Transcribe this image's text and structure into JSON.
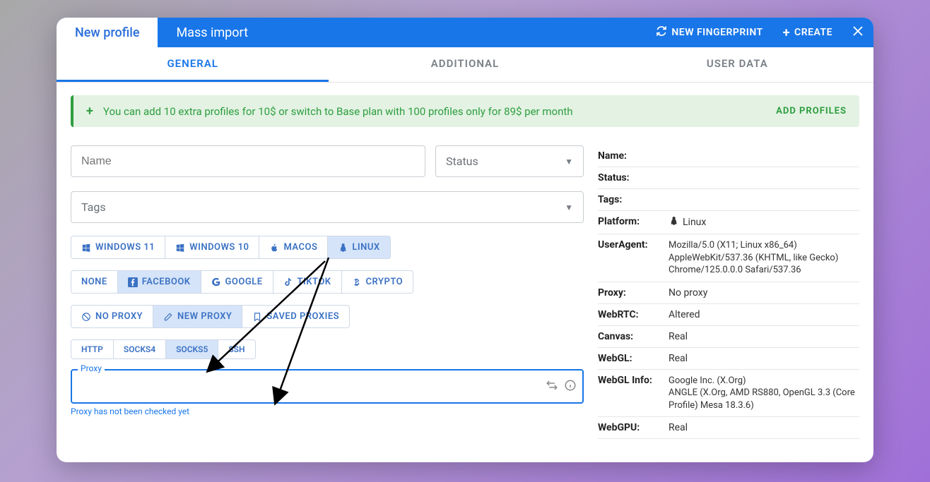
{
  "topbar": {
    "tabs": [
      {
        "label": "New profile",
        "active": true
      },
      {
        "label": "Mass import",
        "active": false
      }
    ],
    "new_fingerprint": "NEW FINGERPRINT",
    "create": "CREATE"
  },
  "subtabs": [
    {
      "label": "GENERAL",
      "active": true
    },
    {
      "label": "ADDITIONAL",
      "active": false
    },
    {
      "label": "USER DATA",
      "active": false
    }
  ],
  "banner": {
    "text": "You can add 10 extra profiles for 10$ or switch to Base plan with 100 profiles only for 89$ per month",
    "action": "ADD PROFILES"
  },
  "form": {
    "name_placeholder": "Name",
    "status_placeholder": "Status",
    "tags_placeholder": "Tags"
  },
  "os_chips": [
    {
      "label": "WINDOWS 11",
      "icon": "windows-icon",
      "selected": false
    },
    {
      "label": "WINDOWS 10",
      "icon": "windows-icon",
      "selected": false
    },
    {
      "label": "MACOS",
      "icon": "apple-icon",
      "selected": false
    },
    {
      "label": "LINUX",
      "icon": "linux-icon",
      "selected": true
    }
  ],
  "app_chips": [
    {
      "label": "NONE",
      "icon": "",
      "selected": false
    },
    {
      "label": "FACEBOOK",
      "icon": "facebook-icon",
      "selected": true
    },
    {
      "label": "GOOGLE",
      "icon": "google-icon",
      "selected": false
    },
    {
      "label": "TIKTOK",
      "icon": "tiktok-icon",
      "selected": false
    },
    {
      "label": "CRYPTO",
      "icon": "bitcoin-icon",
      "selected": false
    }
  ],
  "proxy_mode_chips": [
    {
      "label": "NO PROXY",
      "icon": "noproxy-icon",
      "selected": false
    },
    {
      "label": "NEW PROXY",
      "icon": "edit-icon",
      "selected": true
    },
    {
      "label": "SAVED PROXIES",
      "icon": "bookmark-icon",
      "selected": false
    }
  ],
  "proxy_type_chips": [
    {
      "label": "HTTP",
      "selected": false
    },
    {
      "label": "SOCKS4",
      "selected": false
    },
    {
      "label": "SOCKS5",
      "selected": true
    },
    {
      "label": "SSH",
      "selected": false
    }
  ],
  "proxy_field": {
    "label": "Proxy",
    "hint": "Proxy has not been checked yet"
  },
  "info": {
    "name": {
      "label": "Name:",
      "value": ""
    },
    "status": {
      "label": "Status:",
      "value": ""
    },
    "tags": {
      "label": "Tags:",
      "value": ""
    },
    "platform": {
      "label": "Platform:",
      "value": "Linux"
    },
    "useragent": {
      "label": "UserAgent:",
      "value": "Mozilla/5.0 (X11; Linux x86_64) AppleWebKit/537.36 (KHTML, like Gecko) Chrome/125.0.0.0 Safari/537.36"
    },
    "proxy": {
      "label": "Proxy:",
      "value": "No proxy"
    },
    "webrtc": {
      "label": "WebRTC:",
      "value": "Altered"
    },
    "canvas": {
      "label": "Canvas:",
      "value": "Real"
    },
    "webgl": {
      "label": "WebGL:",
      "value": "Real"
    },
    "webglinfo": {
      "label": "WebGL Info:",
      "value": "Google Inc. (X.Org)\nANGLE (X.Org, AMD RS880, OpenGL 3.3 (Core Profile) Mesa 18.3.6)"
    },
    "webgpu": {
      "label": "WebGPU:",
      "value": "Real"
    }
  }
}
